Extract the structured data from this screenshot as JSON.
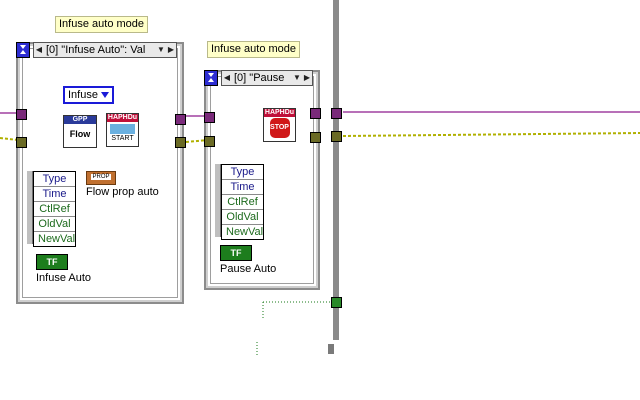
{
  "comments": {
    "left": "Infuse auto mode",
    "right": "Infuse auto mode"
  },
  "left_case": {
    "selector": "[0] \"Infuse Auto\": Val",
    "ring_value": "Infuse",
    "gpp_label": "GPP",
    "flow_label": "Flow",
    "hapdu_label": "HAPHDu",
    "start_label": "START",
    "prop_node_label": "Flow prop auto",
    "prop_node_icon": "PROP",
    "event_fields": [
      "Type",
      "Time",
      "CtlRef",
      "OldVal",
      "NewVal"
    ],
    "bool_const": "TF",
    "bool_label": "Infuse Auto"
  },
  "right_case": {
    "selector": "[0] \"Pause",
    "hapdu_label": "HAPHDu",
    "stop_label": "STOP",
    "event_fields": [
      "Type",
      "Time",
      "CtlRef",
      "OldVal",
      "NewVal"
    ],
    "bool_const": "TF",
    "bool_label": "Pause Auto"
  },
  "colors": {
    "wire_purple": "#a040a0",
    "wire_yellow": "#c8c800",
    "wire_green": "#1a7a1a",
    "wire_orange": "#c07030",
    "ring_blue": "#1a1ad8"
  }
}
